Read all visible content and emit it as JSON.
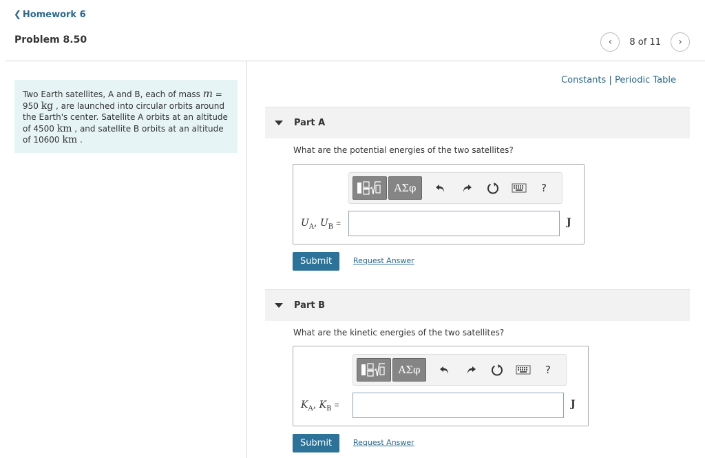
{
  "header": {
    "back_label": "Homework 6",
    "problem_title": "Problem 8.50",
    "pager_text": "8 of 11"
  },
  "problem": {
    "text_1": "Two Earth satellites, A and B, each of mass ",
    "mass_symbol": "m",
    "text_2": " = 950 ",
    "mass_unit": "kg",
    "text_3": " , are launched into circular orbits around the Earth's center. Satellite A orbits at an altitude of 4500 ",
    "unit_km_1": "km",
    "text_4": " , and satellite B orbits at an altitude of 10600 ",
    "unit_km_2": "km",
    "text_5": " ."
  },
  "resources": {
    "constants_label": "Constants",
    "separator": " | ",
    "periodic_label": "Periodic Table"
  },
  "parts": [
    {
      "label": "Part A",
      "question": "What are the potential energies of the two satellites?",
      "var1": "U",
      "sub1": "A",
      "var2": "U",
      "sub2": "B",
      "equals": "=",
      "unit": "J",
      "input_value": "",
      "submit_label": "Submit",
      "request_label": "Request Answer"
    },
    {
      "label": "Part B",
      "question": "What are the kinetic energies of the two satellites?",
      "var1": "K",
      "sub1": "A",
      "var2": "K",
      "sub2": "B",
      "equals": "=",
      "unit": "J",
      "input_value": "",
      "submit_label": "Submit",
      "request_label": "Request Answer"
    }
  ],
  "toolbar": {
    "greek_label": "ΑΣφ",
    "help_label": "?",
    "icons": [
      "templates-icon",
      "greek-letters-icon",
      "undo-icon",
      "redo-icon",
      "reset-icon",
      "keyboard-icon",
      "help-icon"
    ]
  },
  "colors": {
    "link": "#2b6a8f",
    "submit_bg": "#2d7298",
    "problem_bg": "#e6f4f6",
    "part_bar_bg": "#f2f2f2",
    "toolbar_btn": "#858585"
  }
}
